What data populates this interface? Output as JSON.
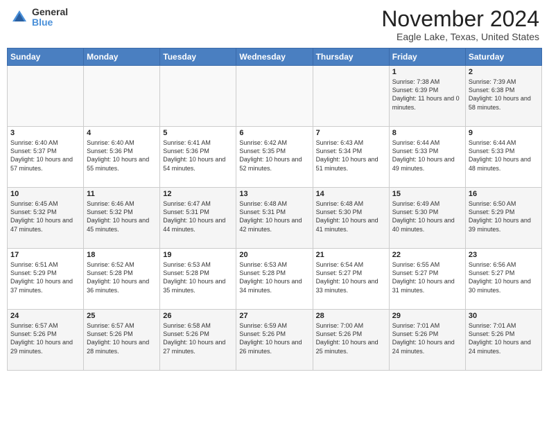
{
  "header": {
    "logo_general": "General",
    "logo_blue": "Blue",
    "month": "November 2024",
    "location": "Eagle Lake, Texas, United States"
  },
  "weekdays": [
    "Sunday",
    "Monday",
    "Tuesday",
    "Wednesday",
    "Thursday",
    "Friday",
    "Saturday"
  ],
  "weeks": [
    [
      {
        "day": "",
        "content": ""
      },
      {
        "day": "",
        "content": ""
      },
      {
        "day": "",
        "content": ""
      },
      {
        "day": "",
        "content": ""
      },
      {
        "day": "",
        "content": ""
      },
      {
        "day": "1",
        "content": "Sunrise: 7:38 AM\nSunset: 6:39 PM\nDaylight: 11 hours and 0 minutes."
      },
      {
        "day": "2",
        "content": "Sunrise: 7:39 AM\nSunset: 6:38 PM\nDaylight: 10 hours and 58 minutes."
      }
    ],
    [
      {
        "day": "3",
        "content": "Sunrise: 6:40 AM\nSunset: 5:37 PM\nDaylight: 10 hours and 57 minutes."
      },
      {
        "day": "4",
        "content": "Sunrise: 6:40 AM\nSunset: 5:36 PM\nDaylight: 10 hours and 55 minutes."
      },
      {
        "day": "5",
        "content": "Sunrise: 6:41 AM\nSunset: 5:36 PM\nDaylight: 10 hours and 54 minutes."
      },
      {
        "day": "6",
        "content": "Sunrise: 6:42 AM\nSunset: 5:35 PM\nDaylight: 10 hours and 52 minutes."
      },
      {
        "day": "7",
        "content": "Sunrise: 6:43 AM\nSunset: 5:34 PM\nDaylight: 10 hours and 51 minutes."
      },
      {
        "day": "8",
        "content": "Sunrise: 6:44 AM\nSunset: 5:33 PM\nDaylight: 10 hours and 49 minutes."
      },
      {
        "day": "9",
        "content": "Sunrise: 6:44 AM\nSunset: 5:33 PM\nDaylight: 10 hours and 48 minutes."
      }
    ],
    [
      {
        "day": "10",
        "content": "Sunrise: 6:45 AM\nSunset: 5:32 PM\nDaylight: 10 hours and 47 minutes."
      },
      {
        "day": "11",
        "content": "Sunrise: 6:46 AM\nSunset: 5:32 PM\nDaylight: 10 hours and 45 minutes."
      },
      {
        "day": "12",
        "content": "Sunrise: 6:47 AM\nSunset: 5:31 PM\nDaylight: 10 hours and 44 minutes."
      },
      {
        "day": "13",
        "content": "Sunrise: 6:48 AM\nSunset: 5:31 PM\nDaylight: 10 hours and 42 minutes."
      },
      {
        "day": "14",
        "content": "Sunrise: 6:48 AM\nSunset: 5:30 PM\nDaylight: 10 hours and 41 minutes."
      },
      {
        "day": "15",
        "content": "Sunrise: 6:49 AM\nSunset: 5:30 PM\nDaylight: 10 hours and 40 minutes."
      },
      {
        "day": "16",
        "content": "Sunrise: 6:50 AM\nSunset: 5:29 PM\nDaylight: 10 hours and 39 minutes."
      }
    ],
    [
      {
        "day": "17",
        "content": "Sunrise: 6:51 AM\nSunset: 5:29 PM\nDaylight: 10 hours and 37 minutes."
      },
      {
        "day": "18",
        "content": "Sunrise: 6:52 AM\nSunset: 5:28 PM\nDaylight: 10 hours and 36 minutes."
      },
      {
        "day": "19",
        "content": "Sunrise: 6:53 AM\nSunset: 5:28 PM\nDaylight: 10 hours and 35 minutes."
      },
      {
        "day": "20",
        "content": "Sunrise: 6:53 AM\nSunset: 5:28 PM\nDaylight: 10 hours and 34 minutes."
      },
      {
        "day": "21",
        "content": "Sunrise: 6:54 AM\nSunset: 5:27 PM\nDaylight: 10 hours and 33 minutes."
      },
      {
        "day": "22",
        "content": "Sunrise: 6:55 AM\nSunset: 5:27 PM\nDaylight: 10 hours and 31 minutes."
      },
      {
        "day": "23",
        "content": "Sunrise: 6:56 AM\nSunset: 5:27 PM\nDaylight: 10 hours and 30 minutes."
      }
    ],
    [
      {
        "day": "24",
        "content": "Sunrise: 6:57 AM\nSunset: 5:26 PM\nDaylight: 10 hours and 29 minutes."
      },
      {
        "day": "25",
        "content": "Sunrise: 6:57 AM\nSunset: 5:26 PM\nDaylight: 10 hours and 28 minutes."
      },
      {
        "day": "26",
        "content": "Sunrise: 6:58 AM\nSunset: 5:26 PM\nDaylight: 10 hours and 27 minutes."
      },
      {
        "day": "27",
        "content": "Sunrise: 6:59 AM\nSunset: 5:26 PM\nDaylight: 10 hours and 26 minutes."
      },
      {
        "day": "28",
        "content": "Sunrise: 7:00 AM\nSunset: 5:26 PM\nDaylight: 10 hours and 25 minutes."
      },
      {
        "day": "29",
        "content": "Sunrise: 7:01 AM\nSunset: 5:26 PM\nDaylight: 10 hours and 24 minutes."
      },
      {
        "day": "30",
        "content": "Sunrise: 7:01 AM\nSunset: 5:26 PM\nDaylight: 10 hours and 24 minutes."
      }
    ]
  ]
}
